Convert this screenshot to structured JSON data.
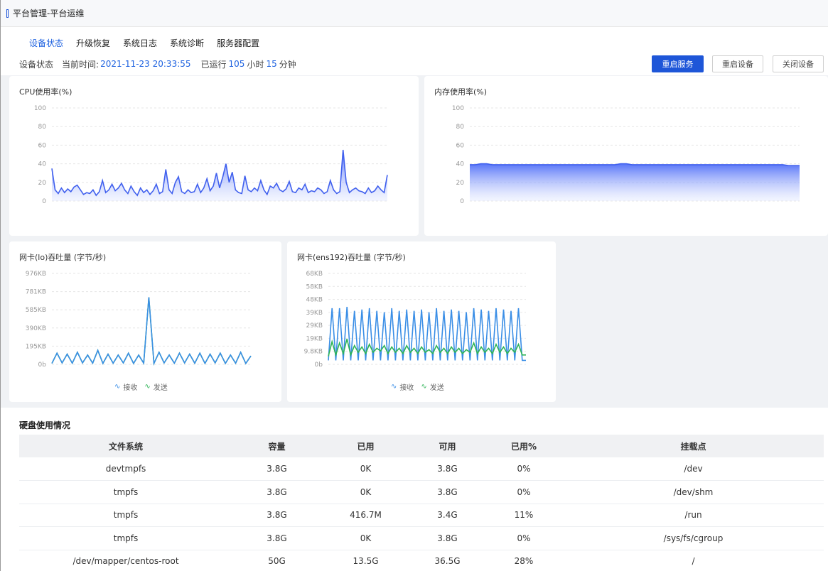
{
  "titlebar": {
    "title": "平台管理-平台运维"
  },
  "tabs": [
    "设备状态",
    "升级恢复",
    "系统日志",
    "系统诊断",
    "服务器配置"
  ],
  "status": {
    "label": "设备状态",
    "time_label": "当前时间:",
    "time_value": "2021-11-23 20:33:55",
    "run_label": "已运行",
    "hours": "105",
    "hours_unit": "小时",
    "minutes": "15",
    "minutes_unit": "分钟"
  },
  "buttons": {
    "restart_service": "重启服务",
    "restart_device": "重启设备",
    "shutdown": "关闭设备"
  },
  "charts": {
    "cpu_title": "CPU使用率(%)",
    "mem_title": "内存使用率(%)",
    "lo_title": "网卡(lo)吞吐量 (字节/秒)",
    "ens_title": "网卡(ens192)吞吐量 (字节/秒)",
    "legend_recv": "接收",
    "legend_send": "发送"
  },
  "chart_data": [
    {
      "type": "area",
      "title": "CPU使用率(%)",
      "ylim": [
        0,
        100
      ],
      "yticks": [
        "100",
        "80",
        "60",
        "40",
        "20",
        "0"
      ],
      "values": [
        35,
        12,
        8,
        14,
        9,
        13,
        10,
        15,
        17,
        12,
        7,
        9,
        8,
        12,
        6,
        10,
        22,
        9,
        12,
        18,
        11,
        14,
        19,
        12,
        8,
        16,
        10,
        6,
        14,
        9,
        12,
        7,
        11,
        18,
        8,
        10,
        34,
        12,
        8,
        20,
        26,
        10,
        8,
        12,
        9,
        10,
        18,
        9,
        14,
        24,
        11,
        16,
        30,
        14,
        26,
        40,
        20,
        31,
        12,
        9,
        8,
        27,
        12,
        10,
        14,
        11,
        22,
        12,
        7,
        16,
        14,
        19,
        12,
        10,
        13,
        21,
        10,
        9,
        14,
        12,
        18,
        9,
        11,
        10,
        14,
        12,
        8,
        10,
        22,
        12,
        8,
        10,
        55,
        20,
        9,
        12,
        14,
        11,
        10,
        8,
        14,
        9,
        11,
        16,
        12,
        9,
        28
      ],
      "series": [
        {
          "name": "",
          "values": []
        }
      ]
    },
    {
      "type": "area",
      "title": "内存使用率(%)",
      "ylim": [
        0,
        100
      ],
      "yticks": [
        "100",
        "80",
        "60",
        "40",
        "20",
        "0"
      ],
      "values": [
        39,
        39,
        40,
        40,
        39,
        39,
        39,
        39,
        39,
        39,
        39,
        39,
        39,
        39,
        39,
        39,
        39,
        39,
        39,
        39,
        39,
        39,
        39,
        39,
        39,
        39,
        39,
        40,
        40,
        39,
        39,
        39,
        39,
        39,
        39,
        39,
        39,
        39,
        39,
        39,
        39,
        39,
        39,
        39,
        39,
        39,
        39,
        39,
        39,
        39,
        39,
        39,
        39,
        39,
        39,
        39,
        39,
        38,
        38,
        38
      ]
    },
    {
      "type": "line",
      "title": "网卡(lo)吞吐量 (字节/秒)",
      "yticks": [
        "976KB",
        "781KB",
        "585KB",
        "390KB",
        "195KB",
        "0b"
      ],
      "ylim_kb": [
        0,
        976
      ],
      "series": [
        {
          "name": "接收",
          "color": "#3a8ee6",
          "values": [
            10,
            120,
            15,
            110,
            12,
            130,
            15,
            100,
            12,
            150,
            10,
            110,
            12,
            100,
            15,
            120,
            10,
            100,
            12,
            720,
            10,
            130,
            15,
            100,
            12,
            120,
            15,
            110,
            12,
            120,
            10,
            110,
            15,
            120,
            10,
            100,
            12,
            130,
            10,
            90
          ]
        },
        {
          "name": "发送",
          "color": "#2fb457",
          "values": [
            10,
            120,
            15,
            110,
            12,
            130,
            15,
            100,
            12,
            150,
            10,
            110,
            12,
            100,
            15,
            120,
            10,
            100,
            12,
            720,
            10,
            130,
            15,
            100,
            12,
            120,
            15,
            110,
            12,
            120,
            10,
            110,
            15,
            120,
            10,
            100,
            12,
            130,
            10,
            90
          ]
        }
      ]
    },
    {
      "type": "line",
      "title": "网卡(ens192)吞吐量 (字节/秒)",
      "yticks": [
        "68KB",
        "58KB",
        "48KB",
        "39KB",
        "29KB",
        "19KB",
        "9.8KB",
        "0b"
      ],
      "ylim_kb": [
        0,
        68
      ],
      "series": [
        {
          "name": "接收",
          "color": "#3a8ee6",
          "values": [
            3,
            42,
            3,
            42,
            3,
            43,
            3,
            40,
            3,
            41,
            3,
            42,
            3,
            40,
            3,
            39,
            3,
            42,
            3,
            40,
            3,
            41,
            3,
            40,
            3,
            41,
            3,
            39,
            3,
            42,
            3,
            40,
            3,
            41,
            3,
            40,
            3,
            39,
            3,
            42,
            3,
            41,
            3,
            40,
            3,
            42,
            3,
            41,
            3,
            40,
            3,
            42,
            3,
            3
          ]
        },
        {
          "name": "发送",
          "color": "#2fb457",
          "values": [
            6,
            17,
            7,
            16,
            8,
            19,
            7,
            14,
            9,
            13,
            8,
            15,
            9,
            12,
            10,
            14,
            8,
            13,
            9,
            12,
            8,
            14,
            9,
            12,
            8,
            13,
            9,
            11,
            8,
            14,
            9,
            12,
            8,
            13,
            9,
            12,
            8,
            11,
            9,
            16,
            8,
            13,
            9,
            12,
            8,
            15,
            9,
            13,
            8,
            12,
            9,
            15,
            7,
            7
          ]
        }
      ]
    }
  ],
  "disk": {
    "title": "硬盘使用情况",
    "headers": [
      "文件系统",
      "容量",
      "已用",
      "可用",
      "已用%",
      "挂载点"
    ],
    "rows": [
      [
        "devtmpfs",
        "3.8G",
        "0K",
        "3.8G",
        "0%",
        "/dev"
      ],
      [
        "tmpfs",
        "3.8G",
        "0K",
        "3.8G",
        "0%",
        "/dev/shm"
      ],
      [
        "tmpfs",
        "3.8G",
        "416.7M",
        "3.4G",
        "11%",
        "/run"
      ],
      [
        "tmpfs",
        "3.8G",
        "0K",
        "3.8G",
        "0%",
        "/sys/fs/cgroup"
      ],
      [
        "/dev/mapper/centos-root",
        "50G",
        "13.5G",
        "36.5G",
        "28%",
        "/"
      ]
    ]
  }
}
